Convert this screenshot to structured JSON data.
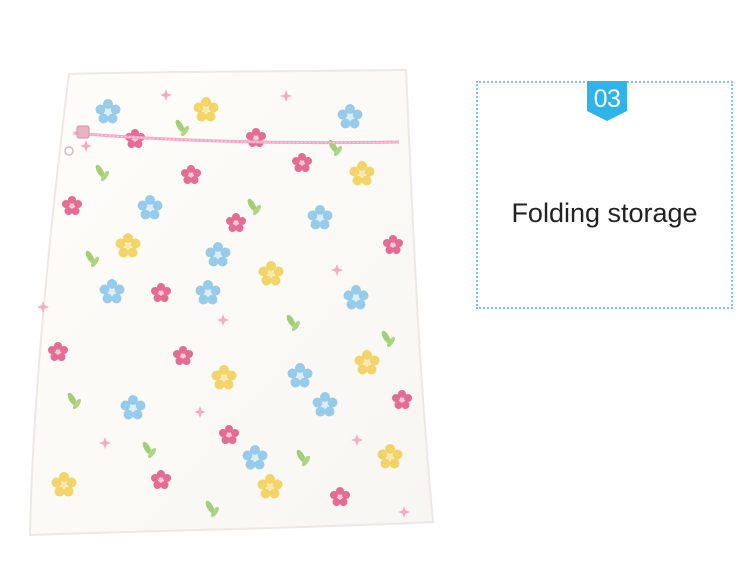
{
  "feature": {
    "number": "03",
    "title": "Folding storage"
  },
  "colors": {
    "accent": "#2fb4e9",
    "border": "#7cc7e6",
    "zipper": "#f3a6c3",
    "bag": "#fdfbf6"
  },
  "icons": {
    "badge": "badge-shape-icon"
  }
}
